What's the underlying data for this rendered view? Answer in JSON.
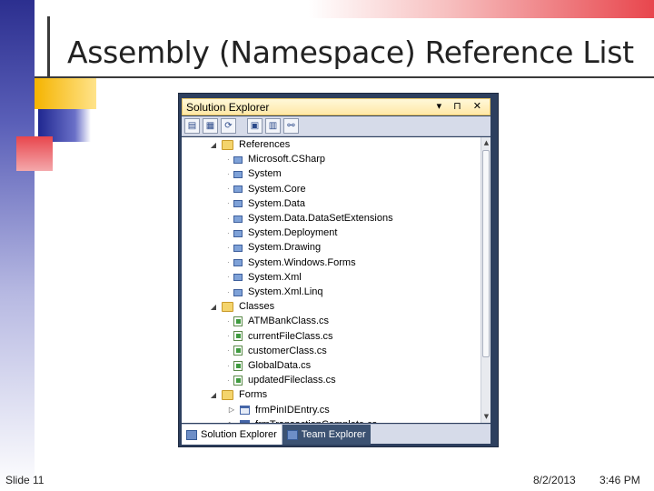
{
  "slide": {
    "title": "Assembly (Namespace) Reference List",
    "slide_number": "Slide 11",
    "date": "8/2/2013",
    "time": "3:46 PM"
  },
  "window": {
    "title": "Solution Explorer",
    "controls": "▾ ⊓ ✕"
  },
  "tree": [
    {
      "label": "References",
      "type": "folder",
      "level": 0,
      "expand": "◢"
    },
    {
      "label": "Microsoft.CSharp",
      "type": "ref",
      "level": 1
    },
    {
      "label": "System",
      "type": "ref",
      "level": 1
    },
    {
      "label": "System.Core",
      "type": "ref",
      "level": 1
    },
    {
      "label": "System.Data",
      "type": "ref",
      "level": 1
    },
    {
      "label": "System.Data.DataSetExtensions",
      "type": "ref",
      "level": 1
    },
    {
      "label": "System.Deployment",
      "type": "ref",
      "level": 1
    },
    {
      "label": "System.Drawing",
      "type": "ref",
      "level": 1
    },
    {
      "label": "System.Windows.Forms",
      "type": "ref",
      "level": 1
    },
    {
      "label": "System.Xml",
      "type": "ref",
      "level": 1
    },
    {
      "label": "System.Xml.Linq",
      "type": "ref",
      "level": 1
    },
    {
      "label": "Classes",
      "type": "folder",
      "level": 0,
      "expand": "◢"
    },
    {
      "label": "ATMBankClass.cs",
      "type": "cs",
      "level": 1
    },
    {
      "label": "currentFileClass.cs",
      "type": "cs",
      "level": 1
    },
    {
      "label": "customerClass.cs",
      "type": "cs",
      "level": 1
    },
    {
      "label": "GlobalData.cs",
      "type": "cs",
      "level": 1
    },
    {
      "label": "updatedFileclass.cs",
      "type": "cs",
      "level": 1
    },
    {
      "label": "Forms",
      "type": "folder",
      "level": 0,
      "expand": "◢"
    },
    {
      "label": "frmPinIDEntry.cs",
      "type": "form",
      "level": 1,
      "expand": "▷"
    },
    {
      "label": "frmTransactionComplete.cs",
      "type": "form",
      "level": 1,
      "expand": "▷"
    }
  ],
  "tabs": [
    {
      "label": "Solution Explorer",
      "active": true
    },
    {
      "label": "Team Explorer",
      "active": false
    }
  ]
}
